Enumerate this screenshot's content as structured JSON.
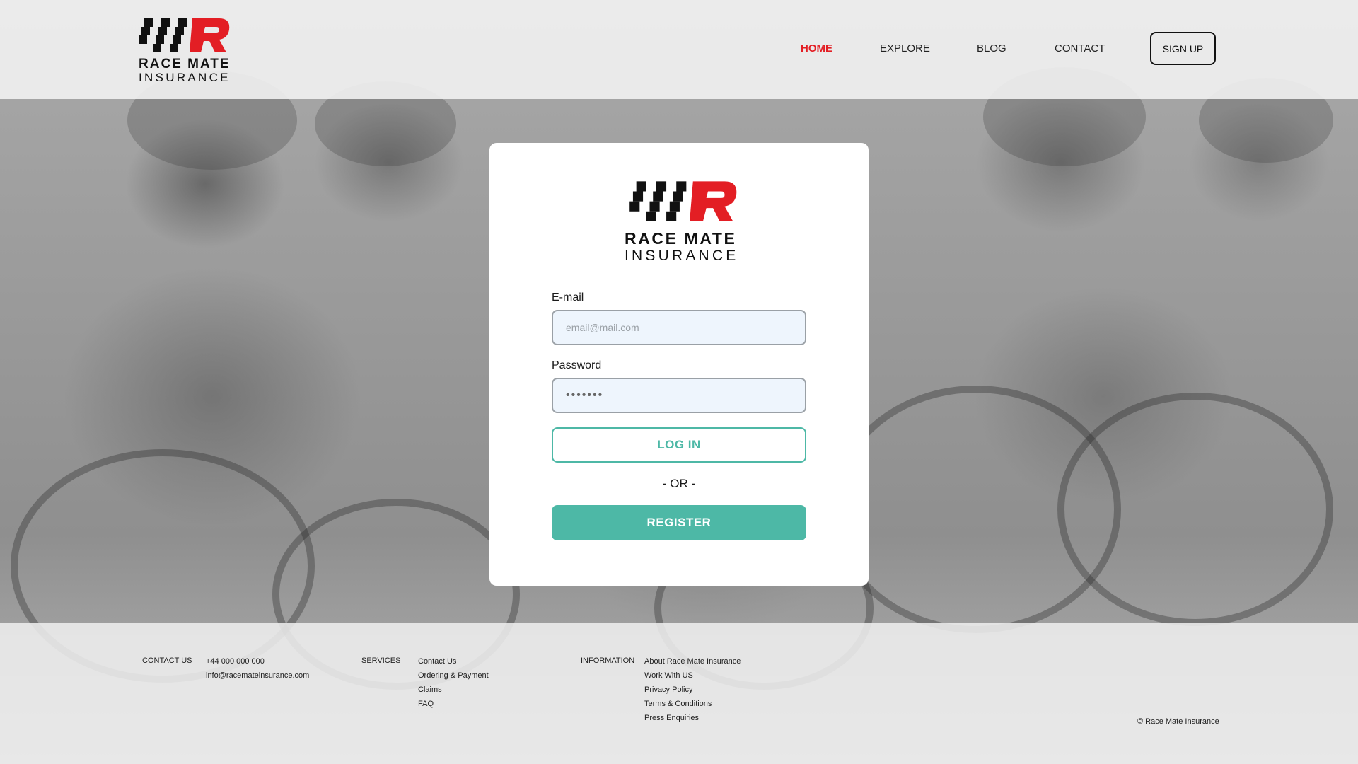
{
  "brand": {
    "line1": "RACE MATE",
    "line2": "INSURANCE",
    "accent_color": "#e31e24"
  },
  "nav": {
    "items": [
      {
        "label": "HOME",
        "active": true
      },
      {
        "label": "EXPLORE",
        "active": false
      },
      {
        "label": "BLOG",
        "active": false
      },
      {
        "label": "CONTACT",
        "active": false
      }
    ],
    "signup_label": "SIGN UP"
  },
  "login": {
    "email_label": "E-mail",
    "email_placeholder": "email@mail.com",
    "password_label": "Password",
    "password_value": "•••••••",
    "login_label": "LOG IN",
    "or_label": "- OR -",
    "register_label": "REGISTER",
    "button_color": "#4db8a6"
  },
  "footer": {
    "contact": {
      "heading": "CONTACT US",
      "items": [
        "+44 000 000 000",
        "info@racemateinsurance.com"
      ]
    },
    "services": {
      "heading": "SERVICES",
      "items": [
        "Contact Us",
        "Ordering & Payment",
        "Claims",
        "FAQ"
      ]
    },
    "information": {
      "heading": "INFORMATION",
      "items": [
        "About Race Mate Insurance",
        "Work With US",
        "Privacy Policy",
        "Terms & Conditions",
        "Press Enquiries"
      ]
    },
    "copyright": "©  Race Mate Insurance"
  }
}
